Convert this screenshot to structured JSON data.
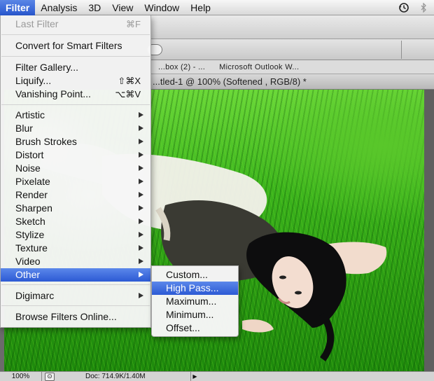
{
  "menubar": {
    "items": [
      "Filter",
      "Analysis",
      "3D",
      "View",
      "Window",
      "Help"
    ],
    "active": "Filter",
    "status_icons": [
      "time-machine-icon",
      "bluetooth-icon"
    ]
  },
  "tasks": [
    "...box (2) - ...",
    "Microsoft Outlook W..."
  ],
  "document_title": "...tled-1 @ 100% (Softened , RGB/8) *",
  "status": {
    "zoom": "100%",
    "doc": "Doc: 714.9K/1.40M"
  },
  "filter_menu": {
    "last_filter": {
      "label": "Last Filter",
      "shortcut": "⌘F"
    },
    "convert": "Convert for Smart Filters",
    "gallery": "Filter Gallery...",
    "liquify": {
      "label": "Liquify...",
      "shortcut": "⇧⌘X"
    },
    "vanishing": {
      "label": "Vanishing Point...",
      "shortcut": "⌥⌘V"
    },
    "categories": [
      "Artistic",
      "Blur",
      "Brush Strokes",
      "Distort",
      "Noise",
      "Pixelate",
      "Render",
      "Sharpen",
      "Sketch",
      "Stylize",
      "Texture",
      "Video",
      "Other"
    ],
    "highlighted": "Other",
    "digimarc": "Digimarc",
    "browse": "Browse Filters Online..."
  },
  "other_submenu": {
    "items": [
      "Custom...",
      "High Pass...",
      "Maximum...",
      "Minimum...",
      "Offset..."
    ],
    "highlighted": "High Pass..."
  },
  "colors": {
    "highlight": "#2c5ad4",
    "grass": "#3cb51d"
  }
}
